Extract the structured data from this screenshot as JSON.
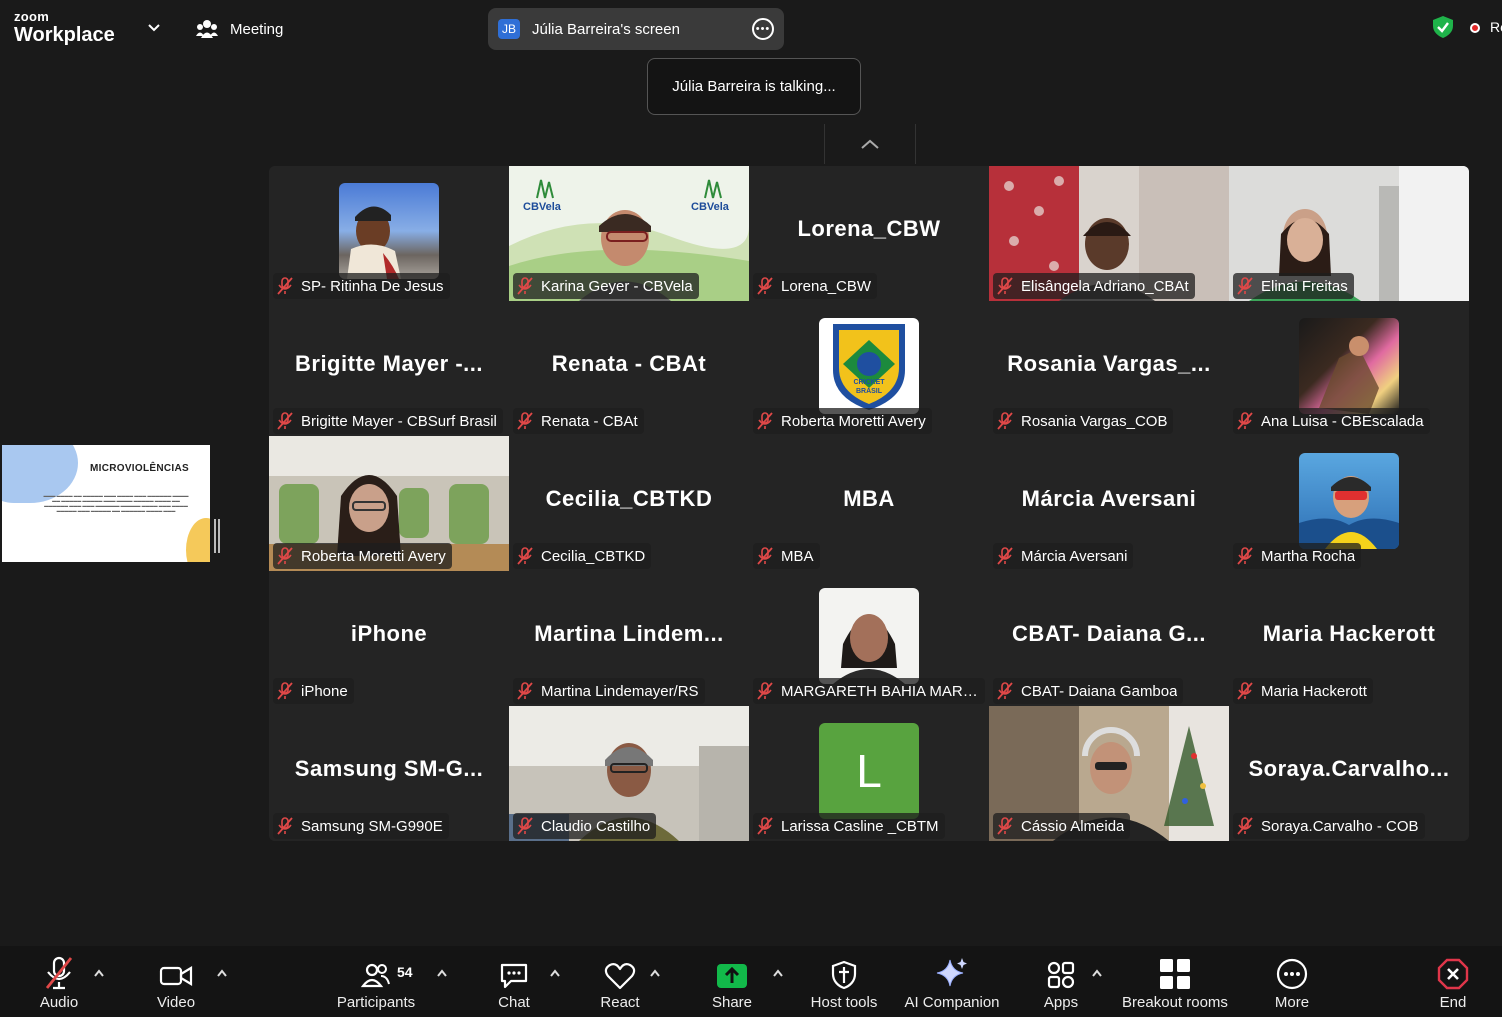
{
  "app": {
    "brand_small": "zoom",
    "brand_large": "Workplace",
    "meeting_label": "Meeting"
  },
  "share": {
    "initials": "JB",
    "label": "Júlia Barreira's screen",
    "talking": "Júlia Barreira is talking...",
    "slide_title": "MICROVIOLÊNCIAS"
  },
  "recording_label": "Re",
  "tiles": [
    {
      "name": "SP- Ritinha De Jesus"
    },
    {
      "name": "Karina Geyer - CBVela"
    },
    {
      "name": "Lorena_CBW",
      "display": "Lorena_CBW"
    },
    {
      "name": "Elisângela Adriano_CBAt"
    },
    {
      "name": "Elinai Freitas"
    },
    {
      "name": "Brigitte Mayer - CBSurf Brasil",
      "display": "Brigitte  Mayer  -..."
    },
    {
      "name": "Renata - CBAt",
      "display": "Renata - CBAt"
    },
    {
      "name": "Roberta Moretti Avery",
      "logo_text": "CRICKET BRASIL"
    },
    {
      "name": "Rosania Vargas_COB",
      "display": "Rosania  Vargas_..."
    },
    {
      "name": "Ana Luisa - CBEscalada"
    },
    {
      "name": "Roberta Moretti Avery"
    },
    {
      "name": "Cecilia_CBTKD",
      "display": "Cecilia_CBTKD"
    },
    {
      "name": "MBA",
      "display": "MBA"
    },
    {
      "name": "Márcia Aversani",
      "display": "Márcia Aversani"
    },
    {
      "name": "Martha Rocha"
    },
    {
      "name": "iPhone",
      "display": "iPhone"
    },
    {
      "name": "Martina Lindemayer/RS",
      "display": "Martina  Lindem..."
    },
    {
      "name": "MARGARETH BAHIA  MARQ..."
    },
    {
      "name": "CBAT- Daiana Gamboa",
      "display": "CBAT-  Daiana  G..."
    },
    {
      "name": "Maria Hackerott",
      "display": "Maria Hackerott"
    },
    {
      "name": "Samsung SM-G990E",
      "display": "Samsung  SM-G..."
    },
    {
      "name": "Claudio Castilho"
    },
    {
      "name": "Larissa Casline _CBTM",
      "avatar_letter": "L"
    },
    {
      "name": "Cássio Almeida"
    },
    {
      "name": "Soraya.Carvalho - COB",
      "display": "Soraya.Carvalho..."
    }
  ],
  "logos": {
    "cbvela": "CBVela"
  },
  "toolbar": {
    "audio": "Audio",
    "video": "Video",
    "participants": "Participants",
    "participants_count": "54",
    "chat": "Chat",
    "react": "React",
    "share": "Share",
    "host_tools": "Host tools",
    "ai_companion": "AI Companion",
    "apps": "Apps",
    "breakout_rooms": "Breakout rooms",
    "more": "More",
    "end": "End"
  },
  "colors": {
    "share_green": "#12b94a",
    "end_red": "#e0364a",
    "mute_red": "#e04848",
    "brand_blue": "#2f6fd6"
  }
}
